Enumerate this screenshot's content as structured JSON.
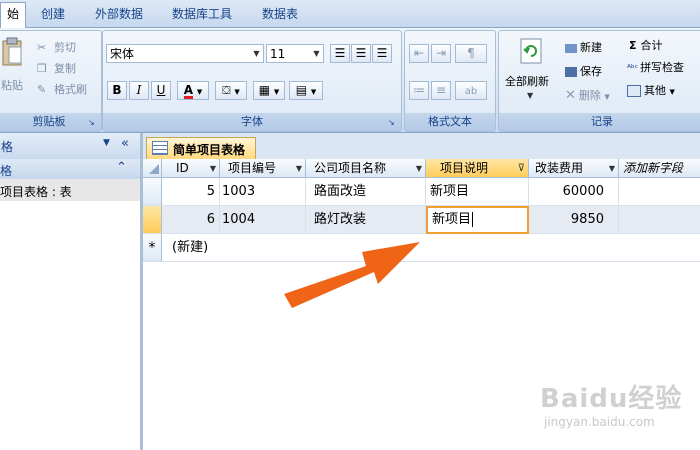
{
  "tabs": [
    {
      "label": "始",
      "active": true
    },
    {
      "label": "创建",
      "active": false
    },
    {
      "label": "外部数据",
      "active": false
    },
    {
      "label": "数据库工具",
      "active": false
    },
    {
      "label": "数据表",
      "active": false
    }
  ],
  "clipboard": {
    "paste": "粘贴",
    "cut": "剪切",
    "copy": "复制",
    "format_painter": "格式刷",
    "title": "剪贴板"
  },
  "font": {
    "name": "宋体",
    "size": "11",
    "bold": "B",
    "italic": "I",
    "underline": "U",
    "color_letter": "A",
    "title": "字体"
  },
  "rich_text": {
    "title": "格式文本"
  },
  "records": {
    "refresh_all": "全部刷新",
    "new": "新建",
    "save": "保存",
    "delete": "删除",
    "sum": "合计",
    "spelling": "拼写检查",
    "more": "其他",
    "title": "记录"
  },
  "nav": {
    "header": "格",
    "item": "项目表格 : 表"
  },
  "document_tab": "简单项目表格",
  "table": {
    "columns": [
      "ID",
      "项目编号",
      "公司项目名称",
      "项目说明",
      "改装费用",
      "添加新字段"
    ],
    "rows": [
      {
        "id": "5",
        "code": "1003",
        "name": "路面改造",
        "desc": "新项目",
        "cost": "60000"
      },
      {
        "id": "6",
        "code": "1004",
        "name": "路灯改装",
        "desc": "新项目",
        "cost": "9850"
      }
    ],
    "new_row_marker": "*",
    "new_row_label": "(新建)"
  },
  "watermark": {
    "brand": "Baidu经验",
    "url": "jingyan.baidu.com"
  },
  "colors": {
    "accent": "#15428b",
    "selected_header": "#ffcc5a",
    "arrow": "#f06418",
    "active_cell_border": "#f0a030"
  }
}
